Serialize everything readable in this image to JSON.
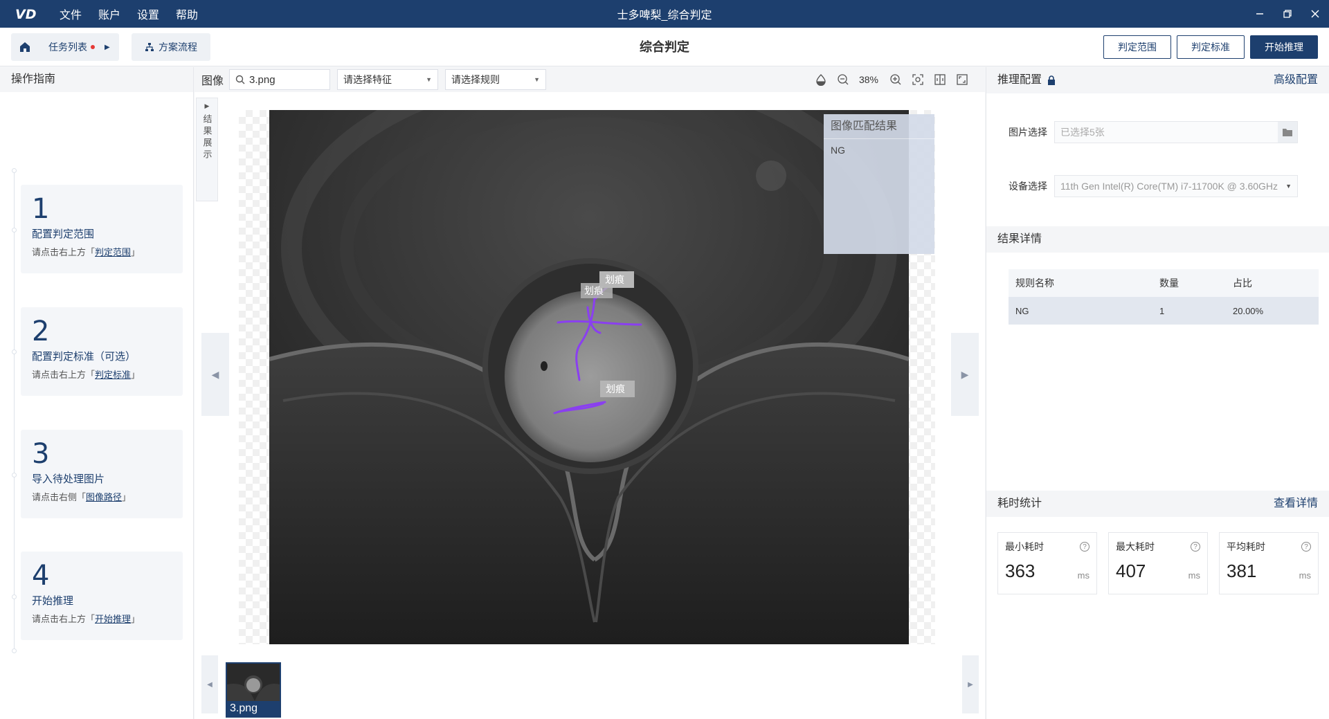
{
  "titlebar": {
    "logo_text": "VD",
    "menu": [
      "文件",
      "账户",
      "设置",
      "帮助"
    ],
    "title": "士多啤梨_综合判定"
  },
  "toolbar": {
    "task_list_label": "任务列表",
    "flow_label": "方案流程",
    "page_title": "综合判定",
    "btn_range": "判定范围",
    "btn_standard": "判定标准",
    "btn_start": "开始推理"
  },
  "guide": {
    "header": "操作指南",
    "steps": [
      {
        "num": "1",
        "title": "配置判定范围",
        "hint_pre": "请点击右上方「",
        "hint_link": "判定范围",
        "hint_post": "」"
      },
      {
        "num": "2",
        "title": "配置判定标准（可选）",
        "hint_pre": "请点击右上方「",
        "hint_link": "判定标准",
        "hint_post": "」"
      },
      {
        "num": "3",
        "title": "导入待处理图片",
        "hint_pre": "请点击右侧「",
        "hint_link": "图像路径",
        "hint_post": "」"
      },
      {
        "num": "4",
        "title": "开始推理",
        "hint_pre": "请点击右上方「",
        "hint_link": "开始推理",
        "hint_post": "」"
      }
    ]
  },
  "center": {
    "image_label": "图像",
    "search_value": "3.png",
    "feature_select": "请选择特征",
    "rule_select": "请选择规则",
    "zoom": "38%",
    "result_tab": "结果展示",
    "match_title": "图像匹配结果",
    "match_value": "NG",
    "defect_labels": [
      "划痕",
      "划痕",
      "划痕"
    ],
    "thumb_label": "3.png"
  },
  "right": {
    "infer_config": "推理配置",
    "advanced": "高级配置",
    "image_select_label": "图片选择",
    "image_select_placeholder": "已选择5张",
    "device_label": "设备选择",
    "device_value": "11th Gen Intel(R) Core(TM) i7-11700K @ 3.60GHz",
    "result_details": "结果详情",
    "table_headers": [
      "规则名称",
      "数量",
      "占比"
    ],
    "table_rows": [
      [
        "NG",
        "1",
        "20.00%"
      ]
    ],
    "timing": "耗时统计",
    "view_details": "查看详情",
    "stats": [
      {
        "label": "最小耗时",
        "value": "363",
        "unit": "ms"
      },
      {
        "label": "最大耗时",
        "value": "407",
        "unit": "ms"
      },
      {
        "label": "平均耗时",
        "value": "381",
        "unit": "ms"
      }
    ]
  },
  "colors": {
    "primary": "#1d3f6e",
    "defect_stroke": "#8a3ff0",
    "alert_dot": "#e53935"
  }
}
